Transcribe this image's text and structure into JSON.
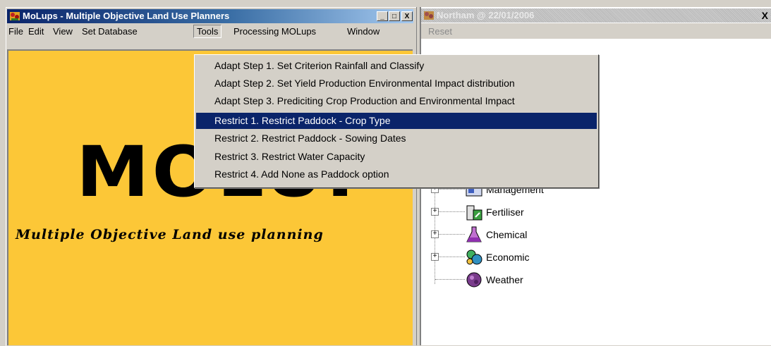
{
  "left_window": {
    "title": "MoLups - Multiple Objective Land Use Planners",
    "menu": [
      "File",
      "Edit",
      "View",
      "Set Database",
      "Tools",
      "Processing MOLups",
      "Window"
    ],
    "logo_big": "MOLUP",
    "logo_sub": "Multiple Objective Land use planning",
    "background_color": "#fcc737"
  },
  "right_window": {
    "title": "Northam @ 22/01/2006",
    "menu_reset": "Reset",
    "close_glyph": "X",
    "tree": [
      {
        "label": "Management",
        "icon": "management-icon"
      },
      {
        "label": "Fertiliser",
        "icon": "fertiliser-icon"
      },
      {
        "label": "Chemical",
        "icon": "chemical-icon"
      },
      {
        "label": "Economic",
        "icon": "economic-icon"
      },
      {
        "label": "Weather",
        "icon": "weather-icon"
      }
    ]
  },
  "tools_menu": {
    "items": [
      "Adapt Step 1. Set Criterion Rainfall and Classify",
      "Adapt Step 2. Set Yield Production  Environmental Impact distribution",
      "Adapt Step 3. Prediciting Crop Production and Environmental Impact",
      "Restrict 1. Restrict Paddock - Crop Type",
      "Restrict 2. Restrict Paddock - Sowing Dates",
      "Restrict 3. Restrict Water Capacity",
      "Restrict 4. Add None as Paddock option"
    ],
    "selected_index": 3,
    "highlight_color": "#0a246a"
  },
  "window_buttons": {
    "minimize": "_",
    "maximize": "□",
    "close": "X"
  }
}
